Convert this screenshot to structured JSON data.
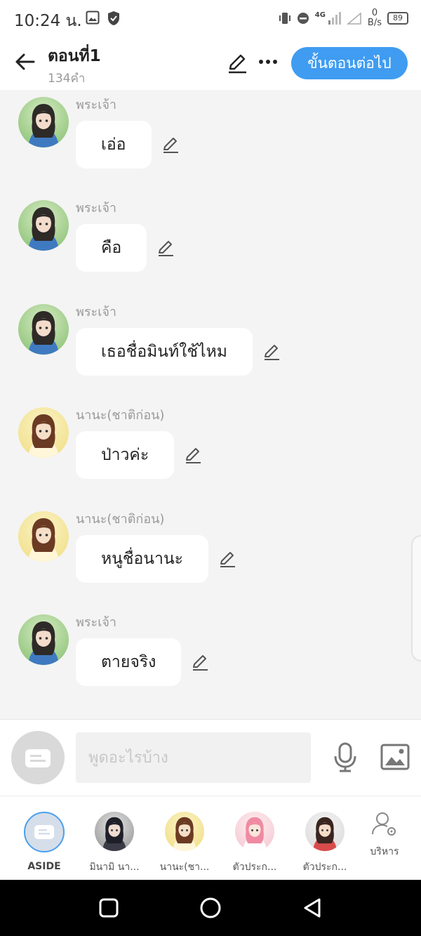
{
  "status_bar": {
    "time": "10:24 น.",
    "speed_value": "0",
    "speed_unit": "B/s",
    "battery": "89",
    "network": "4G"
  },
  "header": {
    "title": "ตอนที่1",
    "word_count": "134คำ",
    "next_button": "ขั้นตอนต่อไป"
  },
  "messages": [
    {
      "speaker": "พระเจ้า",
      "text": "เอ่อ",
      "avatar": "green"
    },
    {
      "speaker": "พระเจ้า",
      "text": "คือ",
      "avatar": "green"
    },
    {
      "speaker": "พระเจ้า",
      "text": "เธอชื่อมินท์ใช้ไหม",
      "avatar": "green"
    },
    {
      "speaker": "นานะ(ชาติก่อน)",
      "text": "ป่าวค่ะ",
      "avatar": "yellow"
    },
    {
      "speaker": "นานะ(ชาติก่อน)",
      "text": "หนูชื่อนานะ",
      "avatar": "yellow"
    },
    {
      "speaker": "พระเจ้า",
      "text": "ตายจริง",
      "avatar": "green"
    }
  ],
  "input": {
    "placeholder": "พูดอะไรบ้าง"
  },
  "characters": [
    {
      "label": "ASIDE"
    },
    {
      "label": "มินามิ นา..."
    },
    {
      "label": "นานะ(ชา..."
    },
    {
      "label": "ตัวประก..."
    },
    {
      "label": "ตัวประก..."
    },
    {
      "label": "บริหาร"
    }
  ],
  "colors": {
    "accent": "#3f9cf1",
    "background": "#f4f4f4",
    "bubble": "#ffffff",
    "speaker": "#9a9a9a"
  }
}
